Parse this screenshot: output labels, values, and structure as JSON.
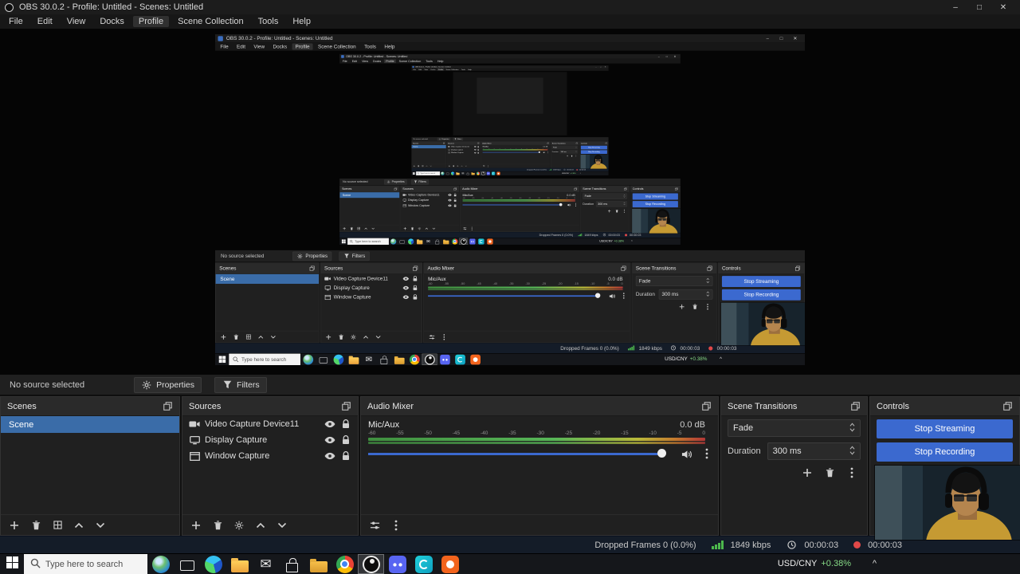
{
  "window": {
    "title": "OBS 30.0.2 - Profile: Untitled - Scenes: Untitled",
    "minimize": "–",
    "maximize": "□",
    "close": "✕"
  },
  "menu": {
    "items": [
      "File",
      "Edit",
      "View",
      "Docks",
      "Profile",
      "Scene Collection",
      "Tools",
      "Help"
    ],
    "active_item": "Profile"
  },
  "selection_bar": {
    "status": "No source selected",
    "properties": "Properties",
    "filters": "Filters"
  },
  "docks": {
    "scenes": {
      "title": "Scenes",
      "items": [
        "Scene"
      ],
      "selected": "Scene"
    },
    "sources": {
      "title": "Sources",
      "items": [
        {
          "name": "Video Capture Device11",
          "icon": "video-camera"
        },
        {
          "name": "Display Capture",
          "icon": "display"
        },
        {
          "name": "Window Capture",
          "icon": "window"
        }
      ]
    },
    "audio_mixer": {
      "title": "Audio Mixer",
      "channel": "Mic/Aux",
      "level": "0.0 dB",
      "ticks": [
        "-60",
        "-55",
        "-50",
        "-45",
        "-40",
        "-35",
        "-30",
        "-25",
        "-20",
        "-15",
        "-10",
        "-5",
        "0"
      ],
      "volume_percent": 97
    },
    "scene_transitions": {
      "title": "Scene Transitions",
      "transition": "Fade",
      "duration_label": "Duration",
      "duration": "300 ms"
    },
    "controls": {
      "title": "Controls",
      "stop_streaming": "Stop Streaming",
      "stop_recording": "Stop Recording"
    }
  },
  "status_bar": {
    "dropped_frames": "Dropped Frames 0 (0.0%)",
    "bitrate": "1849 kbps",
    "stream_time": "00:00:03",
    "record_time": "00:00:03"
  },
  "taskbar": {
    "search_placeholder": "Type here to search",
    "icons": [
      {
        "name": "weather"
      },
      {
        "name": "task-view"
      },
      {
        "name": "edge"
      },
      {
        "name": "file-explorer"
      },
      {
        "name": "mail"
      },
      {
        "name": "store"
      },
      {
        "name": "folder"
      },
      {
        "name": "chrome"
      },
      {
        "name": "obs",
        "active": true
      },
      {
        "name": "discord"
      },
      {
        "name": "teal-app"
      },
      {
        "name": "red-app"
      }
    ],
    "ticker_pair": "USD/CNY",
    "ticker_change": "+0.38%",
    "tray_expand": "^"
  },
  "colors": {
    "accent": "#3b69cf",
    "selection": "#3a6ca8",
    "meter_green": "#4db84d",
    "record_red": "#e04848",
    "positive_green": "#86d986"
  }
}
